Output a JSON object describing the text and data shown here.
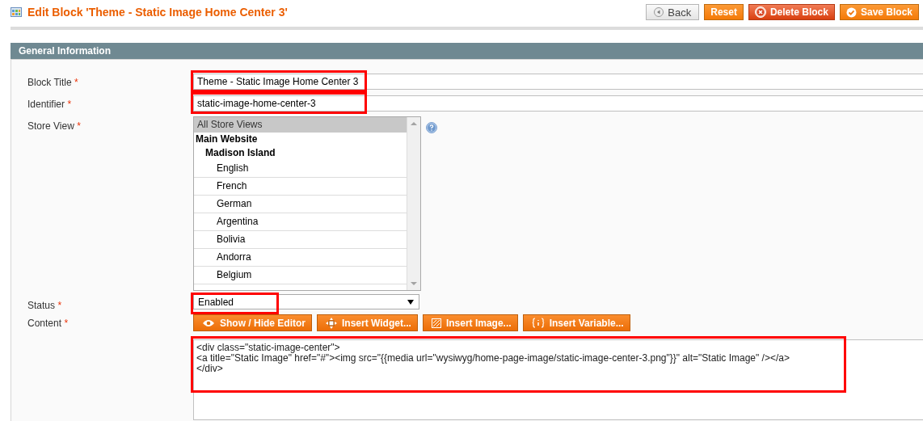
{
  "header": {
    "title": "Edit Block 'Theme - Static Image Home Center 3'",
    "buttons": [
      {
        "label": "Back",
        "kind": "back"
      },
      {
        "label": "Reset",
        "kind": "plain"
      },
      {
        "label": "Delete Block",
        "kind": "delete"
      },
      {
        "label": "Save Block",
        "kind": "save"
      }
    ]
  },
  "section": {
    "title": "General Information"
  },
  "block_title": {
    "label": "Block Title",
    "required_mark": "*",
    "value": "Theme - Static Image Home Center 3",
    "highlighted": true
  },
  "identifier": {
    "label": "Identifier",
    "required_mark": "*",
    "value": "static-image-home-center-3",
    "highlighted": true
  },
  "store_view": {
    "label": "Store View",
    "required_mark": "*",
    "options": [
      {
        "label": "All Store Views",
        "selected": true
      },
      {
        "label": "Main Website",
        "children": [
          {
            "label": "Madison Island",
            "children": [
              {
                "label": "English",
                "selected": false
              },
              {
                "label": "French",
                "selected": false
              },
              {
                "label": "German",
                "selected": false
              },
              {
                "label": "Argentina",
                "selected": false
              },
              {
                "label": "Bolivia",
                "selected": false
              },
              {
                "label": "Andorra",
                "selected": false
              },
              {
                "label": "Belgium",
                "selected": false
              }
            ]
          }
        ]
      }
    ]
  },
  "status": {
    "label": "Status",
    "required_mark": "*",
    "value": "Enabled",
    "highlighted": true
  },
  "content": {
    "label": "Content",
    "required_mark": "*",
    "buttons": [
      {
        "label": "Show / Hide Editor",
        "kind": "eye"
      },
      {
        "label": "Insert Widget...",
        "kind": "widget"
      },
      {
        "label": "Insert Image...",
        "kind": "image"
      },
      {
        "label": "Insert Variable...",
        "kind": "variable"
      }
    ],
    "value": "<div class=\"static-image-center\">\n<a title=\"Static Image\" href=\"#\"><img src=\"{{media url=\"wysiwyg/home-page-image/static-image-center-3.png\"}}\" alt=\"Static Image\" /></a>\n</div>",
    "highlighted": true
  }
}
